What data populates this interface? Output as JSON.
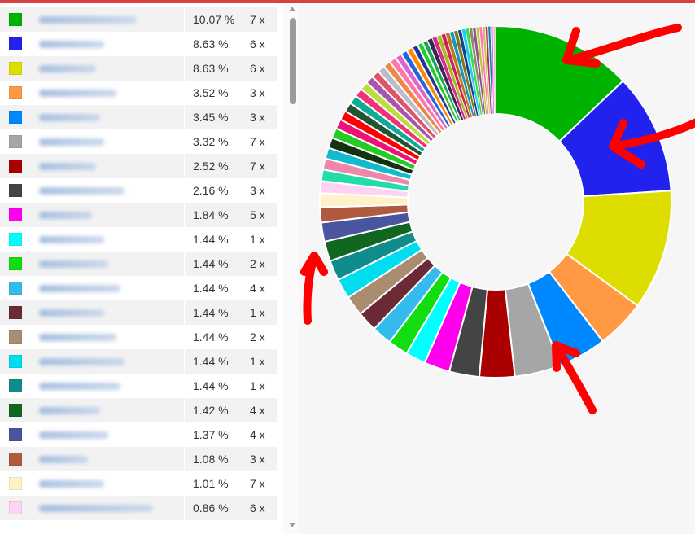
{
  "chart_data": {
    "type": "pie",
    "donut": true,
    "rows": [
      {
        "color": "#00b300",
        "percent": "10.07 %",
        "count": "7 x"
      },
      {
        "color": "#2222ee",
        "percent": "8.63 %",
        "count": "6 x"
      },
      {
        "color": "#dddd00",
        "percent": "8.63 %",
        "count": "6 x"
      },
      {
        "color": "#ff9944",
        "percent": "3.52 %",
        "count": "3 x"
      },
      {
        "color": "#0088ff",
        "percent": "3.45 %",
        "count": "3 x"
      },
      {
        "color": "#a6a6a6",
        "percent": "3.32 %",
        "count": "7 x"
      },
      {
        "color": "#aa0000",
        "percent": "2.52 %",
        "count": "7 x"
      },
      {
        "color": "#444444",
        "percent": "2.16 %",
        "count": "3 x"
      },
      {
        "color": "#ff00ee",
        "percent": "1.84 %",
        "count": "5 x"
      },
      {
        "color": "#00ffff",
        "percent": "1.44 %",
        "count": "1 x"
      },
      {
        "color": "#11dd11",
        "percent": "1.44 %",
        "count": "2 x"
      },
      {
        "color": "#33bbee",
        "percent": "1.44 %",
        "count": "4 x"
      },
      {
        "color": "#6b2a35",
        "percent": "1.44 %",
        "count": "1 x"
      },
      {
        "color": "#aa8c70",
        "percent": "1.44 %",
        "count": "2 x"
      },
      {
        "color": "#00ddee",
        "percent": "1.44 %",
        "count": "1 x"
      },
      {
        "color": "#118c8c",
        "percent": "1.44 %",
        "count": "1 x"
      },
      {
        "color": "#116622",
        "percent": "1.42 %",
        "count": "4 x"
      },
      {
        "color": "#4a55a0",
        "percent": "1.37 %",
        "count": "4 x"
      },
      {
        "color": "#b05a40",
        "percent": "1.08 %",
        "count": "3 x"
      },
      {
        "color": "#fff2c8",
        "percent": "1.01 %",
        "count": "7 x"
      },
      {
        "color": "#ffd3f5",
        "percent": "0.86 %",
        "count": "6 x"
      }
    ],
    "first_slice_values": [
      10.07,
      8.63,
      8.63,
      3.52,
      3.45,
      3.32,
      2.52,
      2.16,
      1.84,
      1.44,
      1.44,
      1.44,
      1.44,
      1.44,
      1.44,
      1.44,
      1.42,
      1.37,
      1.08,
      1.01,
      0.86
    ],
    "first_slice_colors": [
      "#00b300",
      "#2222ee",
      "#dddd00",
      "#ff9944",
      "#0088ff",
      "#a6a6a6",
      "#aa0000",
      "#444444",
      "#ff00ee",
      "#00ffff",
      "#11dd11",
      "#33bbee",
      "#6b2a35",
      "#aa8c70",
      "#00ddee",
      "#118c8c",
      "#116622",
      "#4a55a0",
      "#b05a40",
      "#fff2c8",
      "#ffd3f5"
    ],
    "remaining_slice_values": [
      0.82,
      0.8,
      0.78,
      0.75,
      0.73,
      0.7,
      0.68,
      0.66,
      0.64,
      0.62,
      0.6,
      0.58,
      0.56,
      0.54,
      0.52,
      0.5,
      0.48,
      0.46,
      0.44,
      0.42,
      0.4,
      0.38,
      0.36,
      0.34,
      0.33,
      0.32,
      0.31,
      0.3,
      0.29,
      0.28,
      0.27,
      0.26,
      0.25,
      0.24,
      0.23,
      0.22,
      0.21,
      0.2,
      0.19,
      0.18,
      0.17
    ],
    "remaining_slice_colors": [
      "#22ddaa",
      "#ee88aa",
      "#11bbcc",
      "#113311",
      "#22cc22",
      "#ee1177",
      "#ff0000",
      "#225533",
      "#11aa99",
      "#ee3377",
      "#bbdd44",
      "#aa55aa",
      "#dd5566",
      "#bbbbcc",
      "#ee8844",
      "#ff77aa",
      "#dd66cc",
      "#2266dd",
      "#ff8800",
      "#223399",
      "#22cc22",
      "#11aa55",
      "#442255",
      "#cc3388",
      "#aabb22",
      "#cc2255",
      "#bb7722",
      "#1199bb",
      "#887722",
      "#114488",
      "#22ccee",
      "#33dd55",
      "#998866",
      "#885599",
      "#bbcc33",
      "#ff77cc",
      "#d4c344",
      "#aa3366",
      "#1188aa",
      "#ee66ff",
      "#ccccaa"
    ],
    "arrow_color": "#ff0000"
  }
}
